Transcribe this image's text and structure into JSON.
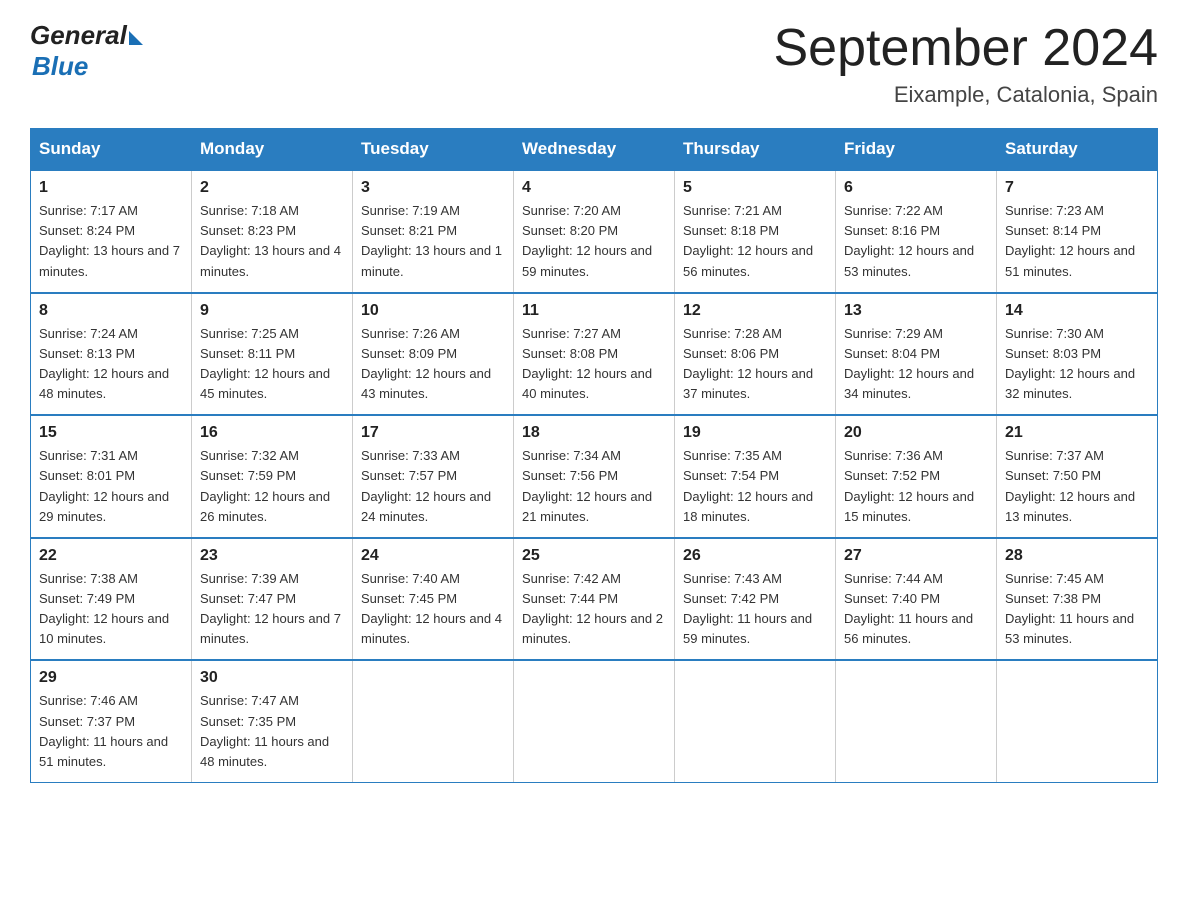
{
  "logo": {
    "general": "General",
    "blue": "Blue"
  },
  "title": "September 2024",
  "location": "Eixample, Catalonia, Spain",
  "days_of_week": [
    "Sunday",
    "Monday",
    "Tuesday",
    "Wednesday",
    "Thursday",
    "Friday",
    "Saturday"
  ],
  "weeks": [
    [
      {
        "day": "1",
        "sunrise": "7:17 AM",
        "sunset": "8:24 PM",
        "daylight": "13 hours and 7 minutes."
      },
      {
        "day": "2",
        "sunrise": "7:18 AM",
        "sunset": "8:23 PM",
        "daylight": "13 hours and 4 minutes."
      },
      {
        "day": "3",
        "sunrise": "7:19 AM",
        "sunset": "8:21 PM",
        "daylight": "13 hours and 1 minute."
      },
      {
        "day": "4",
        "sunrise": "7:20 AM",
        "sunset": "8:20 PM",
        "daylight": "12 hours and 59 minutes."
      },
      {
        "day": "5",
        "sunrise": "7:21 AM",
        "sunset": "8:18 PM",
        "daylight": "12 hours and 56 minutes."
      },
      {
        "day": "6",
        "sunrise": "7:22 AM",
        "sunset": "8:16 PM",
        "daylight": "12 hours and 53 minutes."
      },
      {
        "day": "7",
        "sunrise": "7:23 AM",
        "sunset": "8:14 PM",
        "daylight": "12 hours and 51 minutes."
      }
    ],
    [
      {
        "day": "8",
        "sunrise": "7:24 AM",
        "sunset": "8:13 PM",
        "daylight": "12 hours and 48 minutes."
      },
      {
        "day": "9",
        "sunrise": "7:25 AM",
        "sunset": "8:11 PM",
        "daylight": "12 hours and 45 minutes."
      },
      {
        "day": "10",
        "sunrise": "7:26 AM",
        "sunset": "8:09 PM",
        "daylight": "12 hours and 43 minutes."
      },
      {
        "day": "11",
        "sunrise": "7:27 AM",
        "sunset": "8:08 PM",
        "daylight": "12 hours and 40 minutes."
      },
      {
        "day": "12",
        "sunrise": "7:28 AM",
        "sunset": "8:06 PM",
        "daylight": "12 hours and 37 minutes."
      },
      {
        "day": "13",
        "sunrise": "7:29 AM",
        "sunset": "8:04 PM",
        "daylight": "12 hours and 34 minutes."
      },
      {
        "day": "14",
        "sunrise": "7:30 AM",
        "sunset": "8:03 PM",
        "daylight": "12 hours and 32 minutes."
      }
    ],
    [
      {
        "day": "15",
        "sunrise": "7:31 AM",
        "sunset": "8:01 PM",
        "daylight": "12 hours and 29 minutes."
      },
      {
        "day": "16",
        "sunrise": "7:32 AM",
        "sunset": "7:59 PM",
        "daylight": "12 hours and 26 minutes."
      },
      {
        "day": "17",
        "sunrise": "7:33 AM",
        "sunset": "7:57 PM",
        "daylight": "12 hours and 24 minutes."
      },
      {
        "day": "18",
        "sunrise": "7:34 AM",
        "sunset": "7:56 PM",
        "daylight": "12 hours and 21 minutes."
      },
      {
        "day": "19",
        "sunrise": "7:35 AM",
        "sunset": "7:54 PM",
        "daylight": "12 hours and 18 minutes."
      },
      {
        "day": "20",
        "sunrise": "7:36 AM",
        "sunset": "7:52 PM",
        "daylight": "12 hours and 15 minutes."
      },
      {
        "day": "21",
        "sunrise": "7:37 AM",
        "sunset": "7:50 PM",
        "daylight": "12 hours and 13 minutes."
      }
    ],
    [
      {
        "day": "22",
        "sunrise": "7:38 AM",
        "sunset": "7:49 PM",
        "daylight": "12 hours and 10 minutes."
      },
      {
        "day": "23",
        "sunrise": "7:39 AM",
        "sunset": "7:47 PM",
        "daylight": "12 hours and 7 minutes."
      },
      {
        "day": "24",
        "sunrise": "7:40 AM",
        "sunset": "7:45 PM",
        "daylight": "12 hours and 4 minutes."
      },
      {
        "day": "25",
        "sunrise": "7:42 AM",
        "sunset": "7:44 PM",
        "daylight": "12 hours and 2 minutes."
      },
      {
        "day": "26",
        "sunrise": "7:43 AM",
        "sunset": "7:42 PM",
        "daylight": "11 hours and 59 minutes."
      },
      {
        "day": "27",
        "sunrise": "7:44 AM",
        "sunset": "7:40 PM",
        "daylight": "11 hours and 56 minutes."
      },
      {
        "day": "28",
        "sunrise": "7:45 AM",
        "sunset": "7:38 PM",
        "daylight": "11 hours and 53 minutes."
      }
    ],
    [
      {
        "day": "29",
        "sunrise": "7:46 AM",
        "sunset": "7:37 PM",
        "daylight": "11 hours and 51 minutes."
      },
      {
        "day": "30",
        "sunrise": "7:47 AM",
        "sunset": "7:35 PM",
        "daylight": "11 hours and 48 minutes."
      },
      null,
      null,
      null,
      null,
      null
    ]
  ]
}
